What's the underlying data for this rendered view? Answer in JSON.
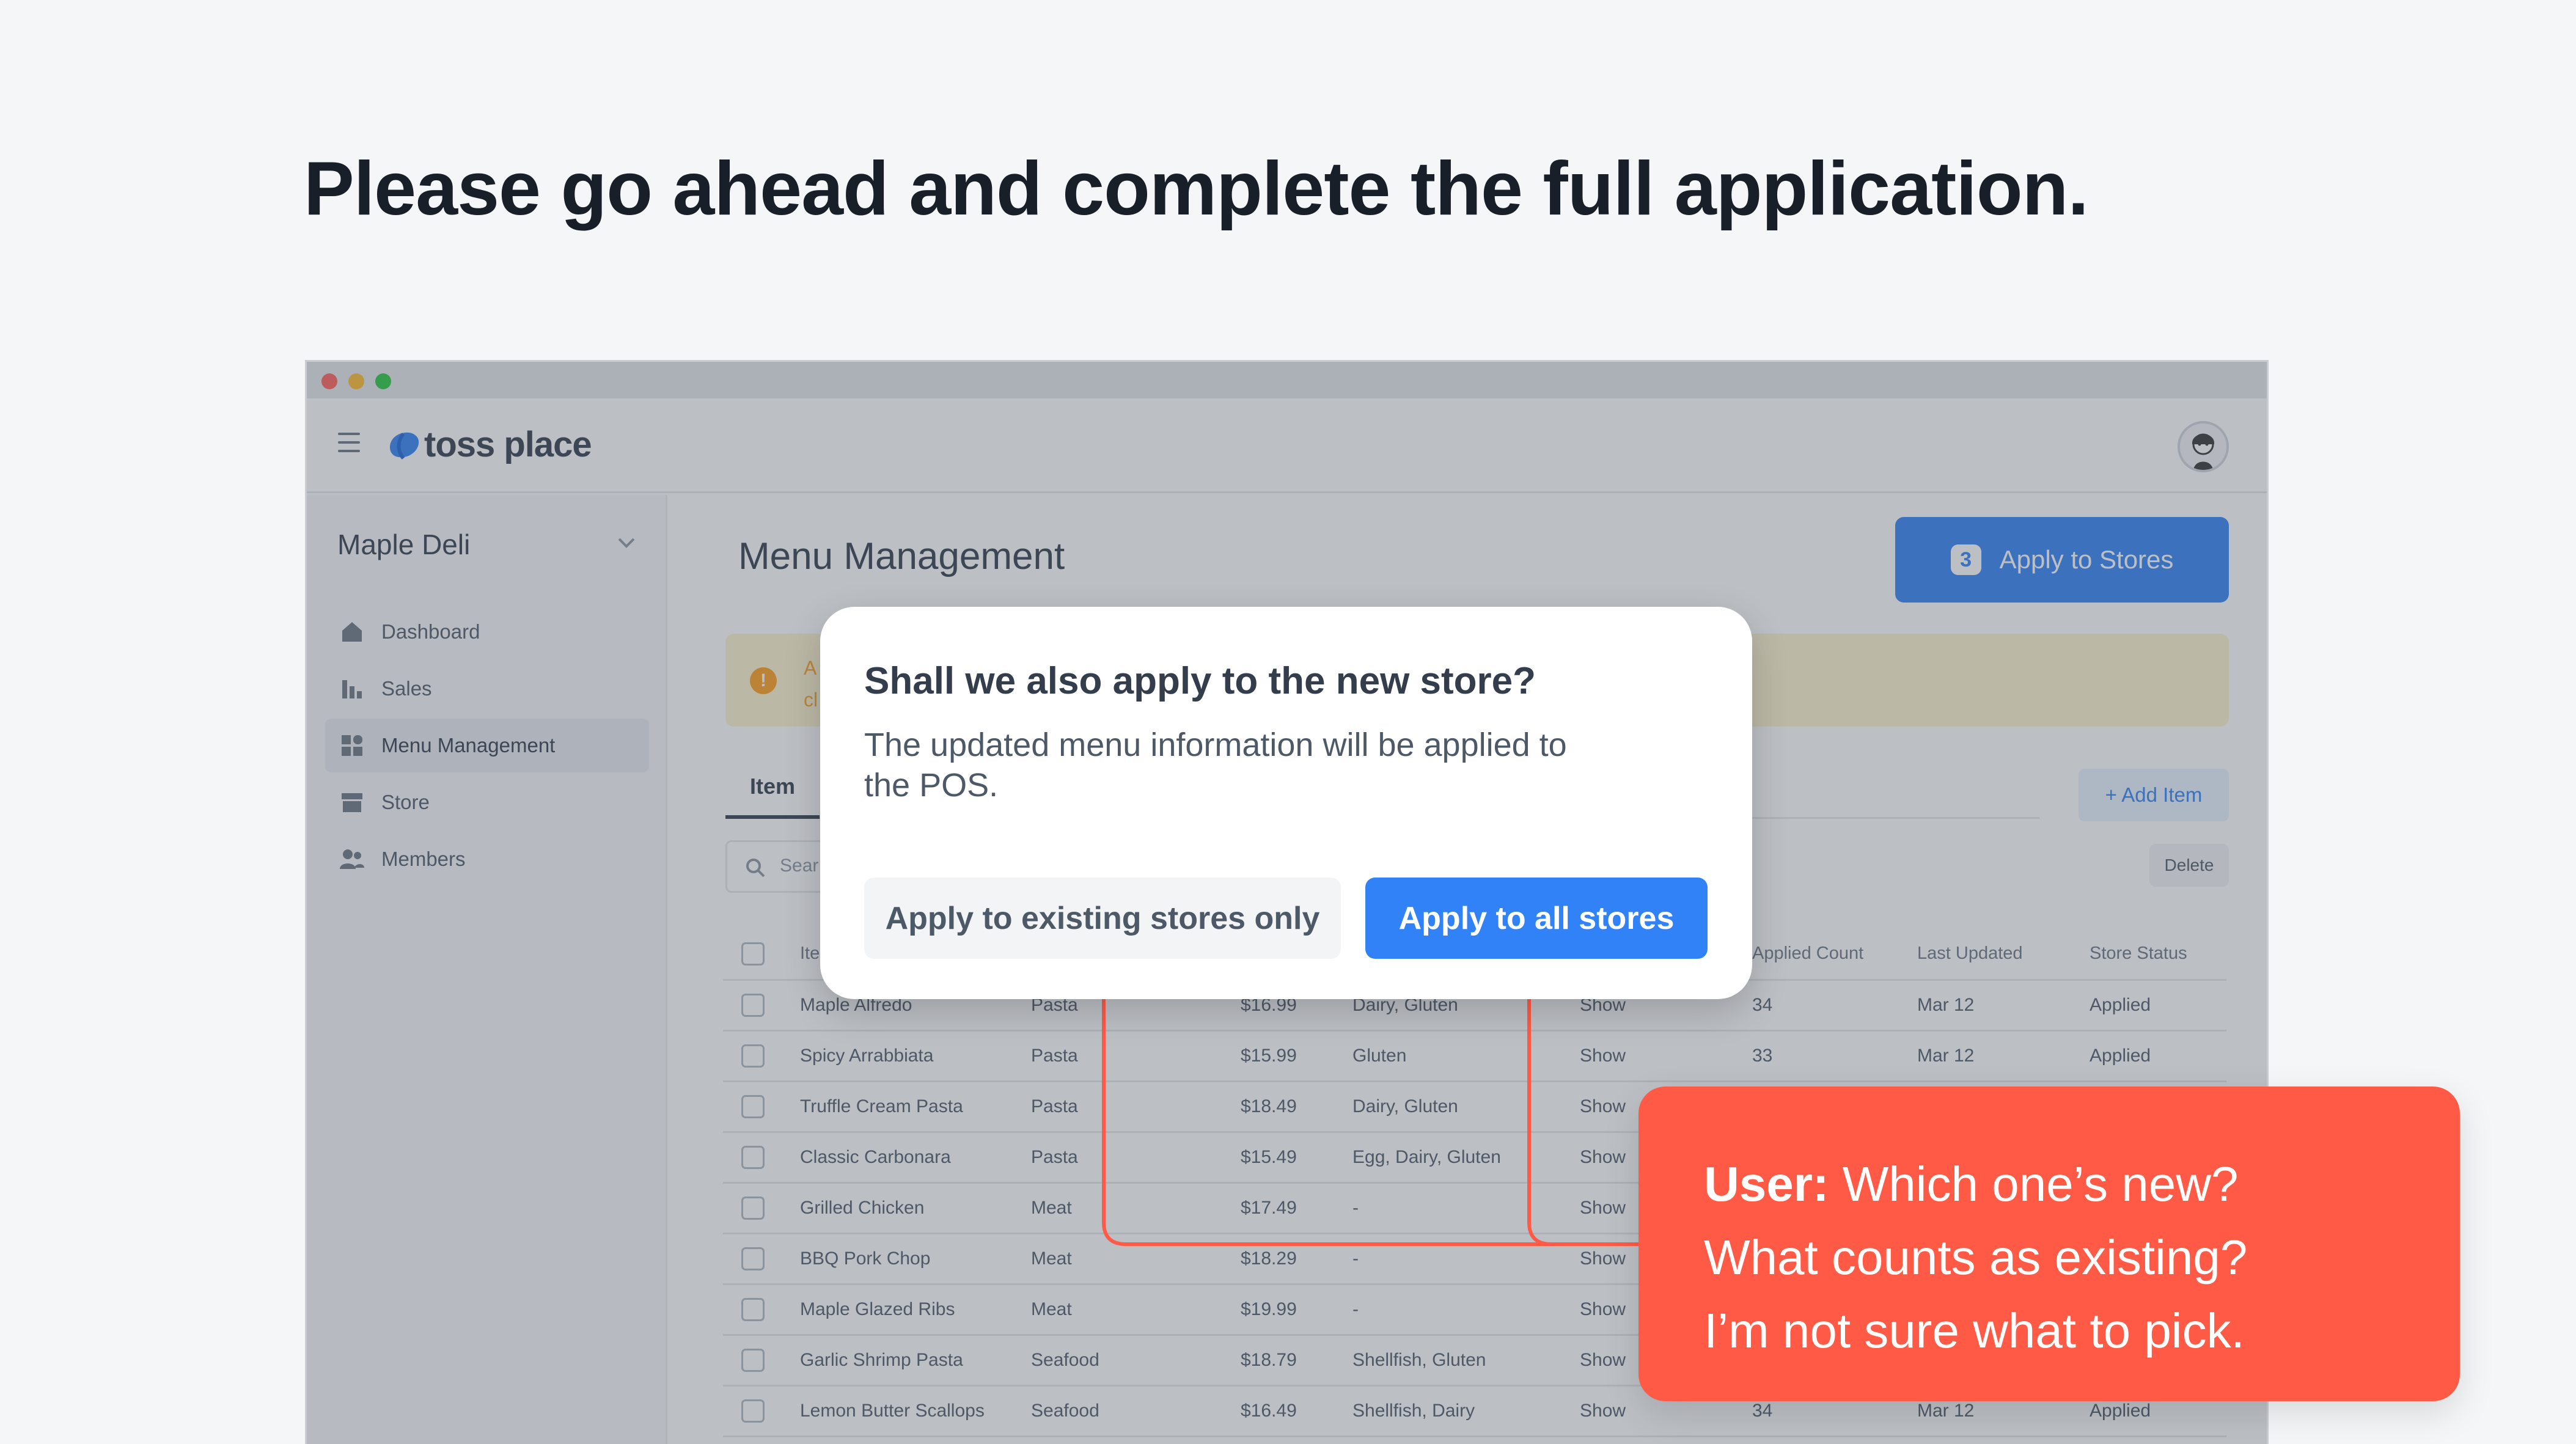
{
  "headline": "Please go ahead and complete the full application.",
  "app": {
    "logo_text": "toss place",
    "store_name": "Maple Deli",
    "nav": [
      {
        "label": "Dashboard",
        "icon": "home-icon"
      },
      {
        "label": "Sales",
        "icon": "bar-chart-icon"
      },
      {
        "label": "Menu Management",
        "icon": "grid-icon",
        "active": true
      },
      {
        "label": "Store",
        "icon": "storefront-icon"
      },
      {
        "label": "Members",
        "icon": "people-icon"
      }
    ],
    "page_title": "Menu Management",
    "apply_button": {
      "count": "3",
      "label": "Apply to Stores"
    },
    "notice_text_line1": "A",
    "notice_text_line2": "cl",
    "tab_item": "Item",
    "add_item_label": "+ Add Item",
    "delete_label": "Delete",
    "search_placeholder": "Sear",
    "table": {
      "headers": [
        "Ite",
        "",
        "",
        "",
        "",
        "Applied Count",
        "Last Updated",
        "Store Status"
      ],
      "rows": [
        [
          "Maple Alfredo",
          "Pasta",
          "$16.99",
          "Dairy, Gluten",
          "Show",
          "34",
          "Mar 12",
          "Applied"
        ],
        [
          "Spicy Arrabbiata",
          "Pasta",
          "$15.99",
          "Gluten",
          "Show",
          "33",
          "Mar 12",
          "Applied"
        ],
        [
          "Truffle Cream Pasta",
          "Pasta",
          "$18.49",
          "Dairy, Gluten",
          "Show",
          "",
          "",
          ""
        ],
        [
          "Classic Carbonara",
          "Pasta",
          "$15.49",
          "Egg, Dairy, Gluten",
          "Show",
          "",
          "",
          ""
        ],
        [
          "Grilled Chicken",
          "Meat",
          "$17.49",
          "-",
          "Show",
          "",
          "",
          ""
        ],
        [
          "BBQ Pork Chop",
          "Meat",
          "$18.29",
          "-",
          "Show",
          "",
          "",
          ""
        ],
        [
          "Maple Glazed Ribs",
          "Meat",
          "$19.99",
          "-",
          "Show",
          "",
          "",
          ""
        ],
        [
          "Garlic Shrimp Pasta",
          "Seafood",
          "$18.79",
          "Shellfish, Gluten",
          "Show",
          "",
          "",
          ""
        ],
        [
          "Lemon Butter Scallops",
          "Seafood",
          "$16.49",
          "Shellfish, Dairy",
          "Show",
          "34",
          "Mar 12",
          "Applied"
        ]
      ]
    }
  },
  "dialog": {
    "title": "Shall we also apply to the new store?",
    "body": "The updated menu information will be applied to the POS.",
    "secondary_label": "Apply to existing stores only",
    "primary_label": "Apply to all stores"
  },
  "callout": {
    "speaker": "User:",
    "line1": "Which one’s new?",
    "line2": "What counts as existing?",
    "line3": "I’m not sure what to pick."
  },
  "colors": {
    "primary": "#3182f6",
    "callout": "#ff5a45",
    "notice": "#fff4cf"
  }
}
